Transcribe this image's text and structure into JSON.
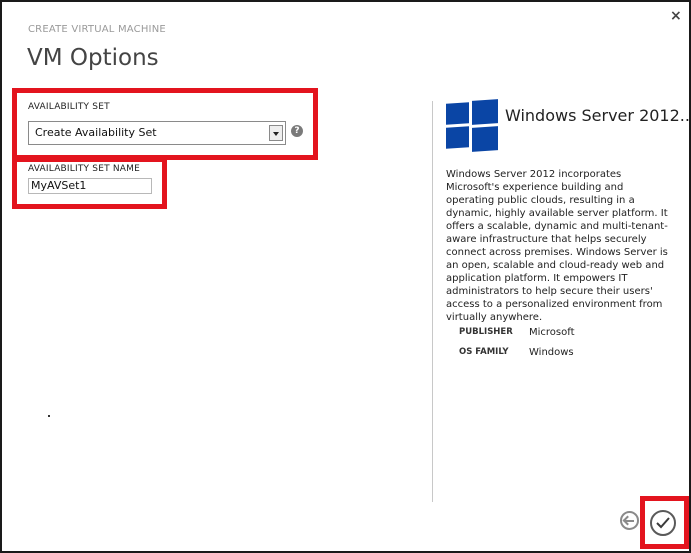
{
  "dialog": {
    "subtitle": "CREATE VIRTUAL MACHINE",
    "title": "VM Options",
    "close_glyph": "×"
  },
  "form": {
    "availability_set": {
      "label": "AVAILABILITY SET",
      "selected": "Create Availability Set",
      "help_glyph": "?"
    },
    "availability_set_name": {
      "label": "AVAILABILITY SET NAME",
      "value": "MyAVSet1"
    }
  },
  "image_info": {
    "name": "Windows Server 2012...",
    "description": "Windows Server 2012 incorporates Microsoft's experience building and operating public clouds, resulting in a dynamic, highly available server platform. It offers a scalable, dynamic and multi-tenant-aware infrastructure that helps securely connect across premises. Windows Server is an open, scalable and cloud-ready web and application platform. It empowers IT administrators to help secure their users' access to a personalized environment from virtually anywhere.",
    "details": [
      {
        "key": "PUBLISHER",
        "value": "Microsoft"
      },
      {
        "key": "OS FAMILY",
        "value": "Windows"
      }
    ]
  },
  "colors": {
    "highlight_border": "#e3141e",
    "windows_logo": "#0a45a5"
  },
  "icons": {
    "close": "close-icon",
    "help": "help-icon",
    "dropdown": "chevron-down-icon",
    "logo": "windows-logo-icon",
    "back": "arrow-left-icon",
    "complete": "checkmark-icon"
  }
}
